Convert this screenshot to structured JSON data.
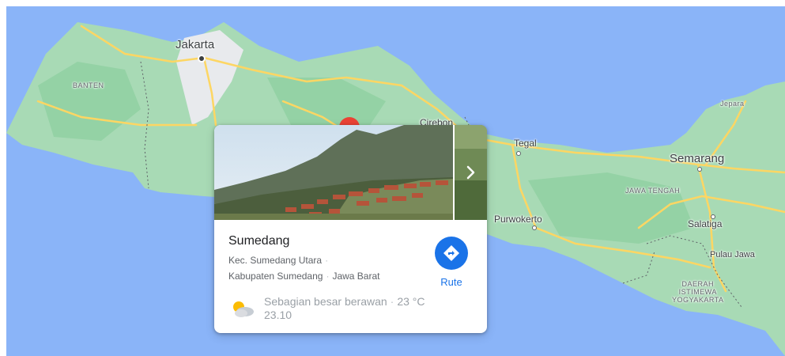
{
  "map": {
    "labels": {
      "jakarta": "Jakarta",
      "banten": "BANTEN",
      "cirebon": "Cirebon",
      "tegal": "Tegal",
      "semarang": "Semarang",
      "jepara": "Jepara",
      "jawa_tengah": "JAWA TENGAH",
      "purwokerto": "Purwokerto",
      "salatiga": "Salatiga",
      "pulau_jawa": "Pulau Jawa",
      "diy_line1": "DAERAH",
      "diy_line2": "ISTIMEWA",
      "diy_line3": "YOGYAKARTA"
    },
    "colors": {
      "water": "#8ab4f8",
      "land": "#a8dab5",
      "roads": "#fdd663",
      "pin": "#ea4335"
    }
  },
  "place_card": {
    "title": "Sumedang",
    "address_line1": "Kec. Sumedang Utara",
    "address_line2_part1": "Kabupaten Sumedang",
    "address_line2_part2": "Jawa Barat",
    "route_label": "Rute",
    "weather_line1_desc": "Sebagian besar berawan",
    "weather_line1_temp": "23 °C",
    "weather_line2_time": "23.10",
    "icons": {
      "route": "directions-icon",
      "weather": "partly-cloudy-icon",
      "next": "chevron-right-icon"
    }
  }
}
